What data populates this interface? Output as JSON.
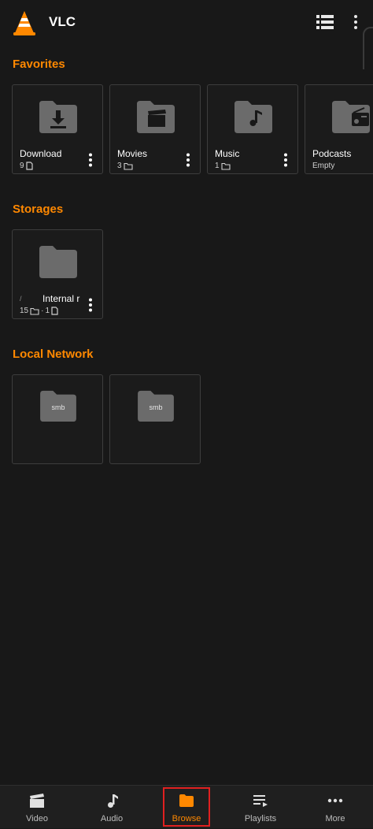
{
  "app": {
    "title": "VLC",
    "accent": "#ff8800"
  },
  "sections": {
    "favorites": "Favorites",
    "storages": "Storages",
    "local_network": "Local Network"
  },
  "favorites": [
    {
      "name": "Download",
      "count": "9",
      "count_icon": "file-icon",
      "folder_icon": "download-icon"
    },
    {
      "name": "Movies",
      "count": "3",
      "count_icon": "folder-icon",
      "folder_icon": "clapperboard-icon"
    },
    {
      "name": "Music",
      "count": "1",
      "count_icon": "folder-icon",
      "folder_icon": "music-note-icon"
    },
    {
      "name": "Podcasts",
      "count": "Empty",
      "count_icon": "",
      "folder_icon": "radio-icon"
    }
  ],
  "storages": [
    {
      "prefix": "/",
      "name": "Internal r",
      "count_folders": "15",
      "separator": "·",
      "count_files": "1"
    }
  ],
  "network": [
    {
      "label": "smb"
    },
    {
      "label": "smb"
    }
  ],
  "bottom_nav": [
    {
      "label": "Video",
      "icon": "clapperboard-icon"
    },
    {
      "label": "Audio",
      "icon": "music-note-icon"
    },
    {
      "label": "Browse",
      "icon": "folder-icon",
      "active": true
    },
    {
      "label": "Playlists",
      "icon": "playlist-icon"
    },
    {
      "label": "More",
      "icon": "more-horizontal-icon"
    }
  ]
}
